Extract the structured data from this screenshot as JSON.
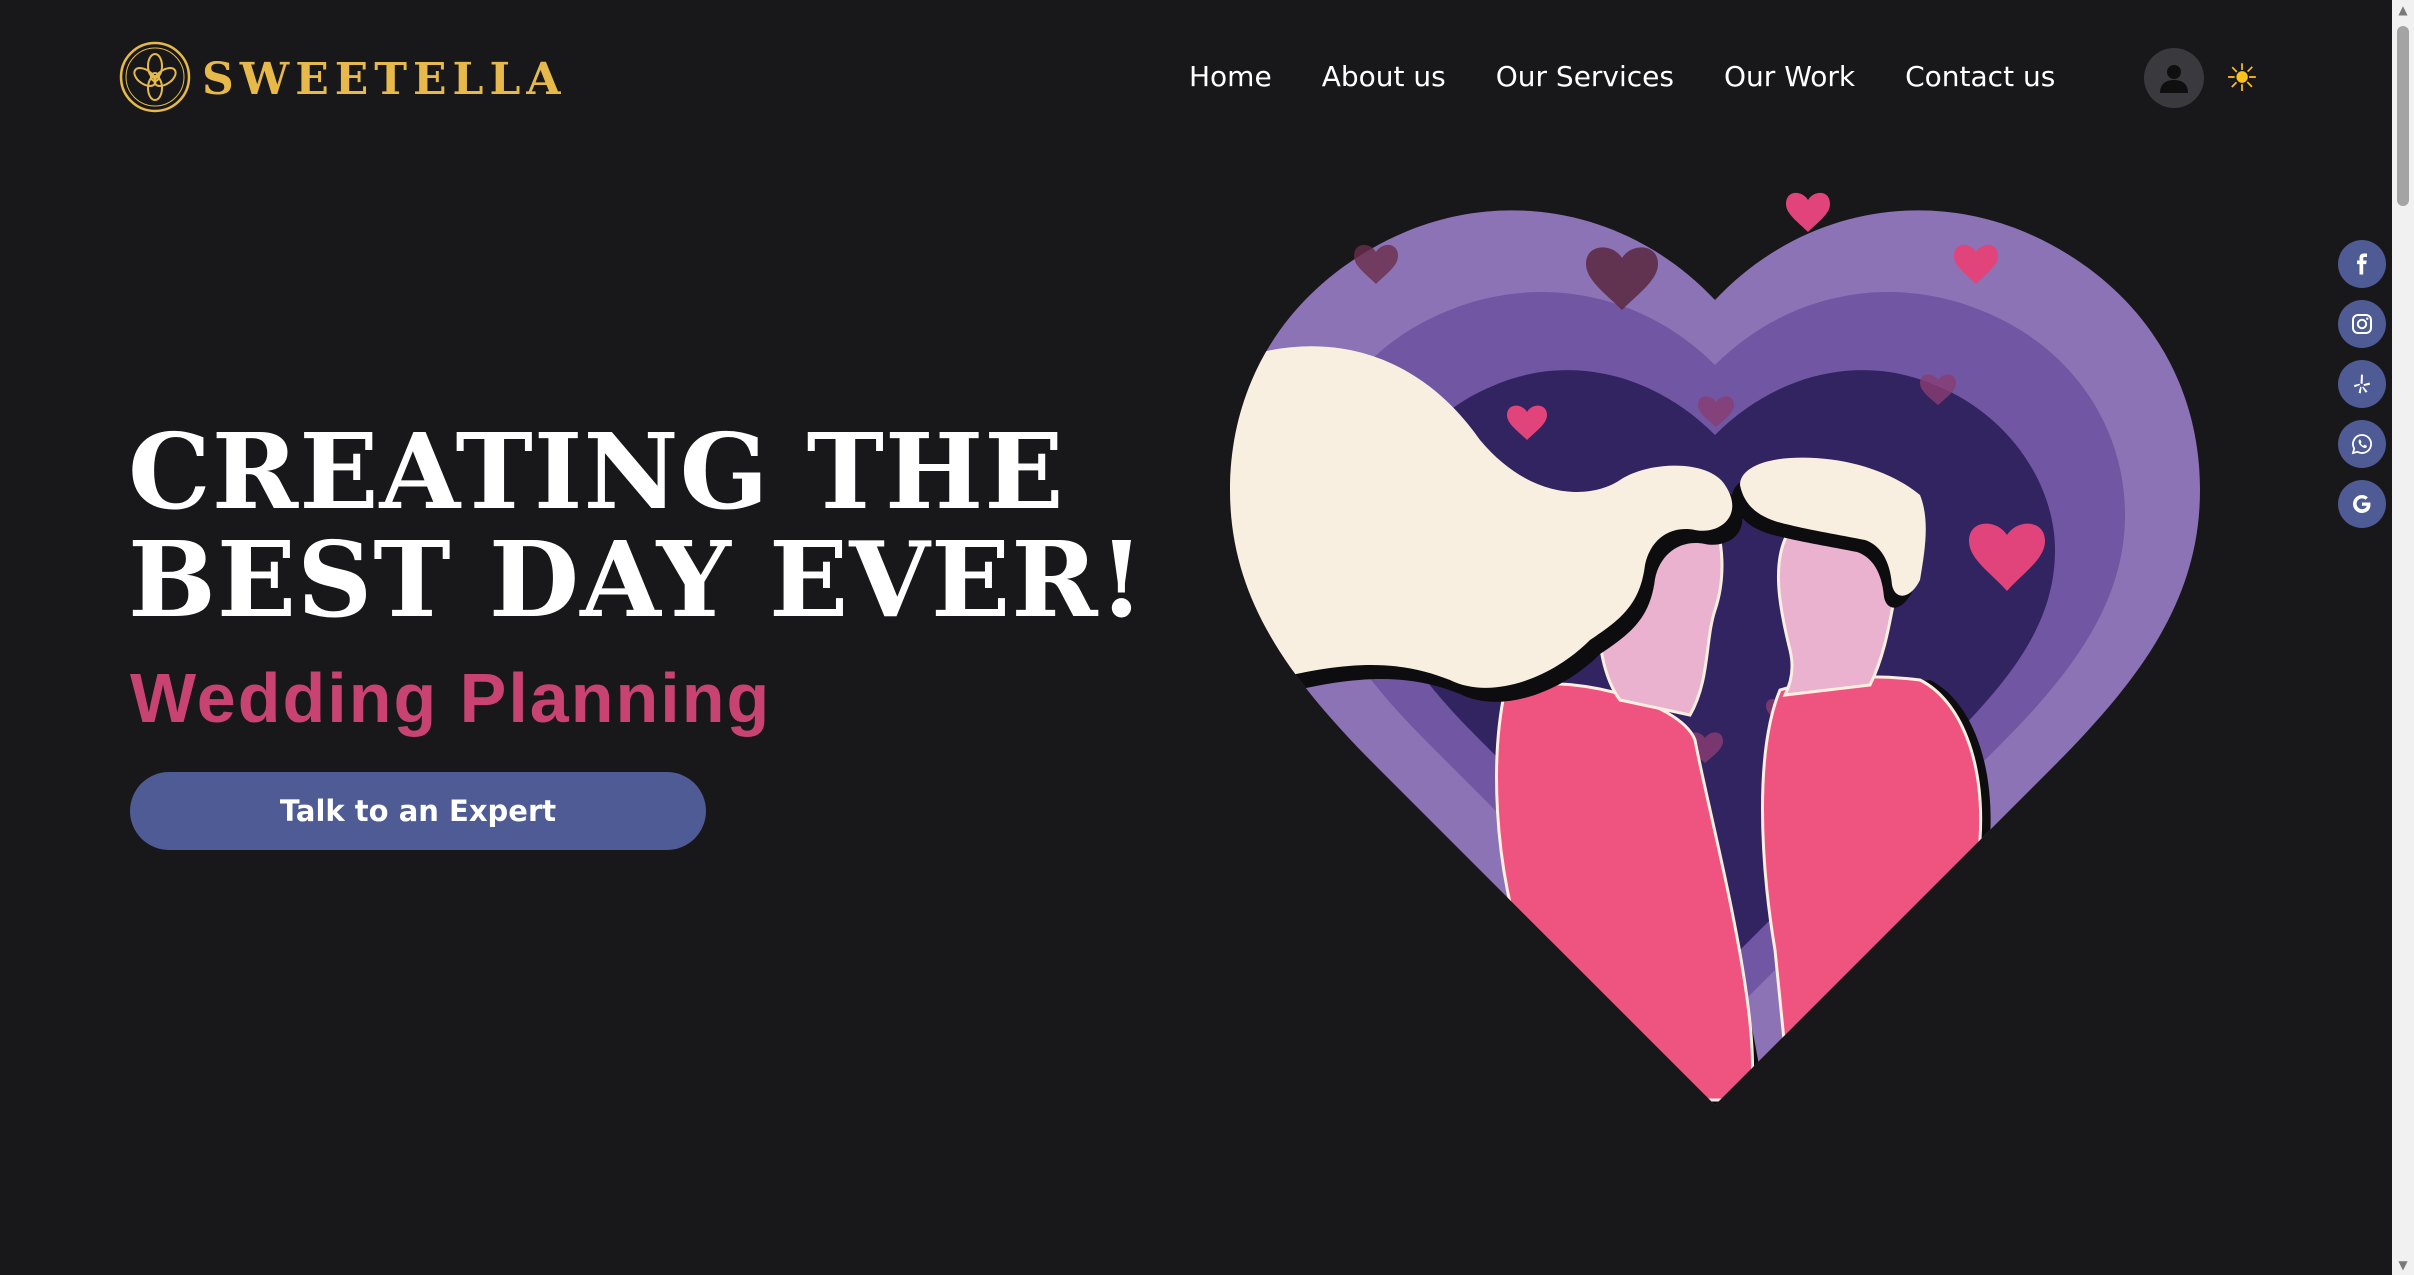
{
  "brand": {
    "name": "SWEETELLA",
    "color": "#e6b94a"
  },
  "nav": {
    "items": [
      {
        "label": "Home"
      },
      {
        "label": "About us"
      },
      {
        "label": "Our Services"
      },
      {
        "label": "Our Work"
      },
      {
        "label": "Contact us"
      }
    ],
    "theme_toggle_icon": "sun-icon",
    "account_icon": "user-icon"
  },
  "hero": {
    "title_line_1": "CREATING THE",
    "title_line_2": "BEST DAY EVER!",
    "subtitle": "Wedding Planning",
    "cta_label": "Talk to an Expert",
    "accent_color": "#c84372",
    "button_color": "#4e5b94"
  },
  "social": [
    {
      "icon": "facebook-icon"
    },
    {
      "icon": "instagram-icon"
    },
    {
      "icon": "yelp-icon"
    },
    {
      "icon": "whatsapp-icon"
    },
    {
      "icon": "google-icon"
    }
  ],
  "illustration": {
    "subject": "couple-in-heart-illustration",
    "colors": {
      "heart_outer": "#8b73b5",
      "heart_mid": "#7156a3",
      "heart_inner": "#322461",
      "hair": "#f9efe1",
      "skin": "#eab2ce",
      "shirt": "#ef5480",
      "small_hearts": "#e0447a"
    }
  }
}
